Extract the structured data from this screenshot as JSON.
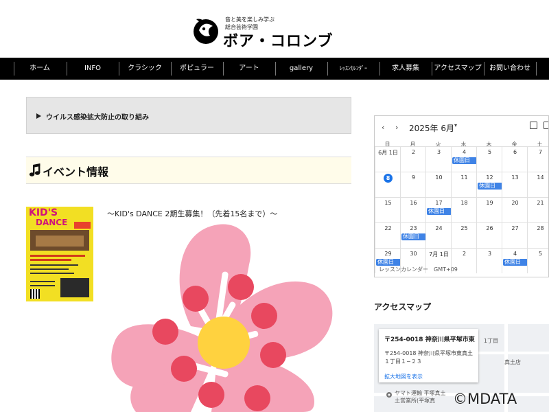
{
  "header": {
    "tagline_1": "音と美を楽しみ学ぶ",
    "tagline_2": "総合芸術学園",
    "brand": "ボア・コロンブ"
  },
  "nav": {
    "items": [
      {
        "label": "ホーム"
      },
      {
        "label": "INFO"
      },
      {
        "label": "クラシック"
      },
      {
        "label": "ポピュラー"
      },
      {
        "label": "アート"
      },
      {
        "label": "gallery"
      },
      {
        "label": "ﾚｯｽﾝｶﾚﾝﾀﾞｰ"
      },
      {
        "label": "求人募集"
      },
      {
        "label": "アクセスマップ"
      },
      {
        "label": "お問い合わせ"
      }
    ]
  },
  "covid": {
    "label": "ウイルス感染拡大防止の取り組み"
  },
  "event": {
    "title": "イベント情報",
    "caption": "〜KID's DANCE 2期生募集！（先着15名まで）〜",
    "poster_title": "KID'S",
    "poster_sub": "DANCE"
  },
  "calendar": {
    "month_label": "2025年 6月",
    "weekdays": [
      "日",
      "月",
      "火",
      "水",
      "木",
      "金",
      "土"
    ],
    "weeks": [
      [
        {
          "d": "6月 1日"
        },
        {
          "d": "2"
        },
        {
          "d": "3"
        },
        {
          "d": "4",
          "ev": "休園日"
        },
        {
          "d": "5"
        },
        {
          "d": "6"
        },
        {
          "d": "7"
        }
      ],
      [
        {
          "d": "8",
          "today": true
        },
        {
          "d": "9"
        },
        {
          "d": "10"
        },
        {
          "d": "11"
        },
        {
          "d": "12",
          "ev": "休園日"
        },
        {
          "d": "13"
        },
        {
          "d": "14"
        }
      ],
      [
        {
          "d": "15"
        },
        {
          "d": "16"
        },
        {
          "d": "17",
          "ev": "休園日"
        },
        {
          "d": "18"
        },
        {
          "d": "19"
        },
        {
          "d": "20"
        },
        {
          "d": "21"
        }
      ],
      [
        {
          "d": "22"
        },
        {
          "d": "23",
          "ev": "休園日"
        },
        {
          "d": "24"
        },
        {
          "d": "25"
        },
        {
          "d": "26"
        },
        {
          "d": "27"
        },
        {
          "d": "28"
        }
      ],
      [
        {
          "d": "29",
          "ev": "休園日"
        },
        {
          "d": "30"
        },
        {
          "d": "7月 1日"
        },
        {
          "d": "2"
        },
        {
          "d": "3"
        },
        {
          "d": "4",
          "ev": "休園日"
        },
        {
          "d": "5"
        }
      ]
    ],
    "footer": "レッスンカレンダー　GMT+09"
  },
  "access": {
    "title": "アクセスマップ",
    "card_title": "〒254-0018 神奈川県平塚市東...",
    "card_address": "〒254-0018 神奈川県平塚市東真土１丁目１−２３",
    "card_link": "拡大地図を表示",
    "map_label_1": "1丁目",
    "map_label_2": "ヤマト運輸 平塚真土",
    "map_label_3": "土営業所(平塚真",
    "map_label_4": "真土店",
    "copyright": "©MDATA"
  },
  "colors": {
    "nav_bg": "#000000",
    "event_band": "#fffcea",
    "calendar_event": "#3f83e6",
    "today": "#1a73e8",
    "flower_petal": "#f5a3b8",
    "flower_center": "#ffd23f",
    "flower_dot": "#e8485f"
  },
  "icons": [
    "dove-logo-icon",
    "triangle-right-icon",
    "music-note-icon",
    "chevron-left-icon",
    "chevron-right-icon",
    "calendar-icon",
    "map-pin-icon"
  ]
}
